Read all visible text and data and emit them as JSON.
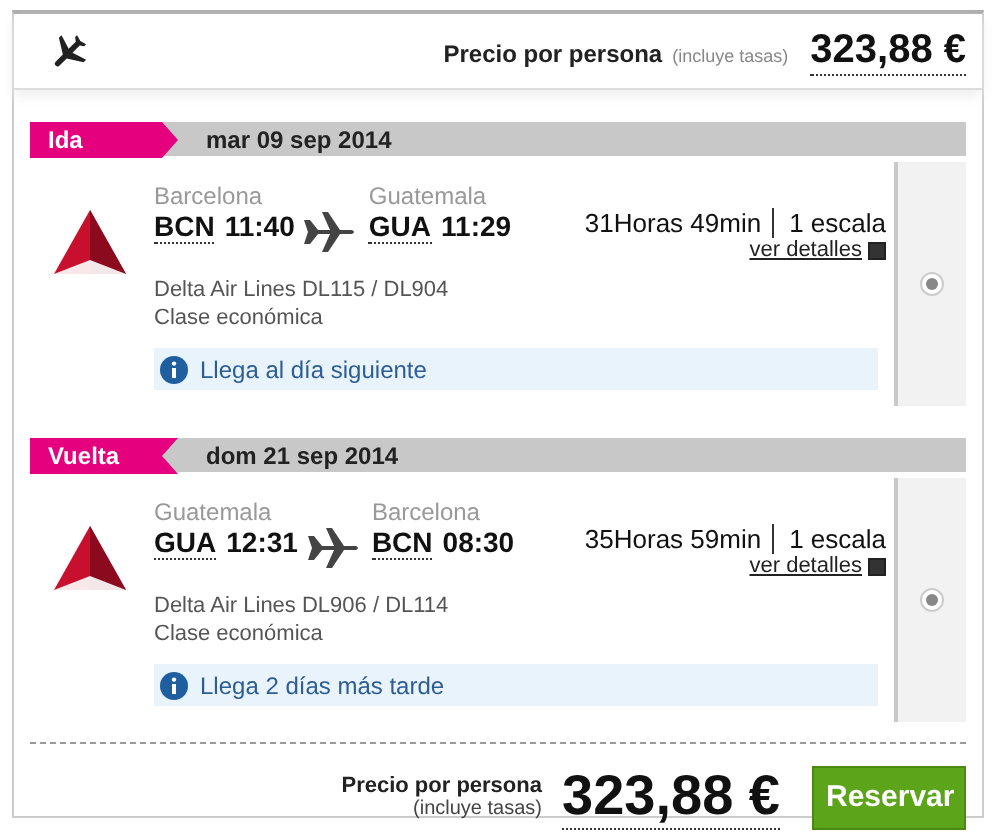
{
  "header": {
    "price_label": "Precio por persona",
    "price_note": "(incluye tasas)",
    "price": "323,88 €"
  },
  "legs": [
    {
      "kind": "outbound",
      "tag": "Ida",
      "date": "mar 09 sep 2014",
      "from_city": "Barcelona",
      "from_code": "BCN",
      "from_time": "11:40",
      "to_city": "Guatemala",
      "to_code": "GUA",
      "to_time": "11:29",
      "duration": "31Horas 49min",
      "stops": "1 escala",
      "details": "ver detalles",
      "airline": "Delta Air Lines DL115 / DL904",
      "cabin": "Clase económica",
      "notice": "Llega al día siguiente",
      "selected": true
    },
    {
      "kind": "return",
      "tag": "Vuelta",
      "date": "dom 21 sep 2014",
      "from_city": "Guatemala",
      "from_code": "GUA",
      "from_time": "12:31",
      "to_city": "Barcelona",
      "to_code": "BCN",
      "to_time": "08:30",
      "duration": "35Horas 59min",
      "stops": "1 escala",
      "details": "ver detalles",
      "airline": "Delta Air Lines DL906 / DL114",
      "cabin": "Clase económica",
      "notice": "Llega 2 días más tarde",
      "selected": true
    }
  ],
  "footer": {
    "price_label": "Precio por persona",
    "price_note": "(incluye tasas)",
    "price": "323,88 €",
    "button": "Reservar"
  }
}
